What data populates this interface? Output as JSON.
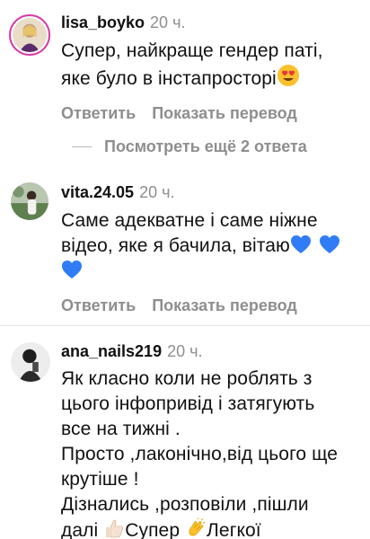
{
  "comments": [
    {
      "username": "lisa_boyko",
      "time": "20 ч.",
      "lines": [
        "Супер, найкраще гендер паті,",
        "яке було в інстапросторі"
      ],
      "emoji_end": "heart-eyes",
      "reply_label": "Ответить",
      "translate_label": "Показать перевод"
    },
    {
      "username": "vita.24.05",
      "time": "20 ч.",
      "lines": [
        "Саме адекватне і саме ніжне",
        "відео, яке я бачила, вітаю"
      ],
      "emoji_end": "blue-heart x3",
      "reply_label": "Ответить",
      "translate_label": "Показать перевод"
    },
    {
      "username": "ana_nails219",
      "time": "20 ч.",
      "lines": [
        "Як класно коли не роблять з",
        "цього інфопривід і затягують",
        "все на тижні .",
        "Просто ,лаконічно,від цього ще",
        "крутіше !",
        "Дізнались ,розповіли ,пішли",
        "далі",
        "Супер",
        "Легкої"
      ]
    }
  ],
  "view_replies_label": "Посмотреть ещё 2 ответа",
  "colors": {
    "secondary_text": "#8e8e8e",
    "story_ring": "#d93aa6",
    "heart_blue": "#2f7cf6",
    "emoji_yellow": "#fbc02d"
  }
}
